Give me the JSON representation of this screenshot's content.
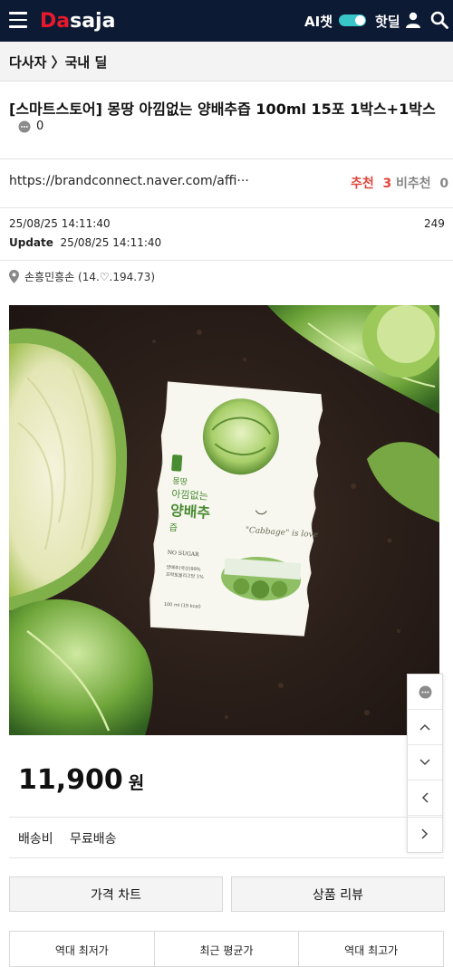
{
  "header": {
    "logo_text_red": "Da",
    "logo_text_white": "saja",
    "ai_chat_label": "AI챗",
    "ai_toggle_on": true,
    "hotdeal_label": "핫딜",
    "accent_color": "#38c6c9",
    "brand_color": "#e8192c",
    "icons": [
      "menu-icon",
      "user-icon",
      "search-icon"
    ]
  },
  "breadcrumb": "다사자 〉국내 딜",
  "post": {
    "title": "[스마트스토어] 몽땅 아낌없는 양배추즙 100ml 15포 1박스+1박스",
    "comment_count": "0",
    "link": "https://brandconnect.naver.com/affi···",
    "recommend_label": "추천",
    "recommend_count": "3",
    "nonrecommend_label": "비추천",
    "nonrecommend_count": "0",
    "date": "25/08/25 14:11:40",
    "views": "249",
    "update_label": "Update",
    "update_date": "25/08/25 14:11:40",
    "author": "손흥민흥손 (14.♡.194.73)"
  },
  "product_image": {
    "pouch_brand": "몽땅",
    "pouch_line1": "아낌없는",
    "pouch_line2": "양배추",
    "pouch_line3": "즙",
    "pouch_script": "\"Cabbage\" is love",
    "pouch_nosugar": "NO SUGAR",
    "pouch_ingredient1": "양배추(국산)99%",
    "pouch_ingredient2": "프락토올리고당 1%",
    "pouch_volume": "100 ml (19 kcal)"
  },
  "price": {
    "amount": "11,900",
    "unit": "원"
  },
  "shipping": {
    "label": "배송비",
    "value": "무료배송"
  },
  "buttons": {
    "price_chart": "가격 차트",
    "product_review": "상품 리뷰"
  },
  "stats": {
    "all_time_low": "역대 최저가",
    "recent_avg": "최근 평균가",
    "all_time_high": "역대 최고가"
  },
  "floating_nav": [
    "comment-icon",
    "arrow-up-icon",
    "arrow-down-icon",
    "arrow-left-icon",
    "arrow-right-icon"
  ]
}
